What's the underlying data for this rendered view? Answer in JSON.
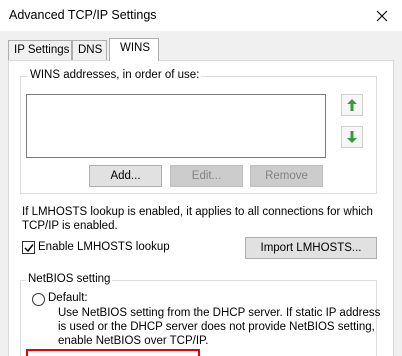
{
  "window": {
    "title": "Advanced TCP/IP Settings"
  },
  "tabs": [
    {
      "label": "IP Settings",
      "active": false
    },
    {
      "label": "DNS",
      "active": false
    },
    {
      "label": "WINS",
      "active": true
    }
  ],
  "wins": {
    "group_label": "WINS addresses, in order of use:",
    "addresses": [],
    "up_icon": "arrow-up-icon",
    "down_icon": "arrow-down-icon",
    "add_label": "Add...",
    "edit_label": "Edit...",
    "remove_label": "Remove"
  },
  "lmhosts": {
    "info_line1": "If LMHOSTS lookup is enabled, it applies to all connections for which",
    "info_line2": "TCP/IP is enabled.",
    "enable_label": "Enable LMHOSTS lookup",
    "enable_checked": true,
    "import_label": "Import LMHOSTS..."
  },
  "netbios": {
    "group_label": "NetBIOS setting",
    "default_label": "Default:",
    "default_selected": false,
    "desc_line1": "Use NetBIOS setting from the DHCP server. If static IP address",
    "desc_line2": "is used or the DHCP server does not provide NetBIOS setting,",
    "desc_line3": "enable NetBIOS over TCP/IP."
  },
  "colors": {
    "highlight": "#e8000b",
    "arrow_green": "#3c9a3c"
  }
}
